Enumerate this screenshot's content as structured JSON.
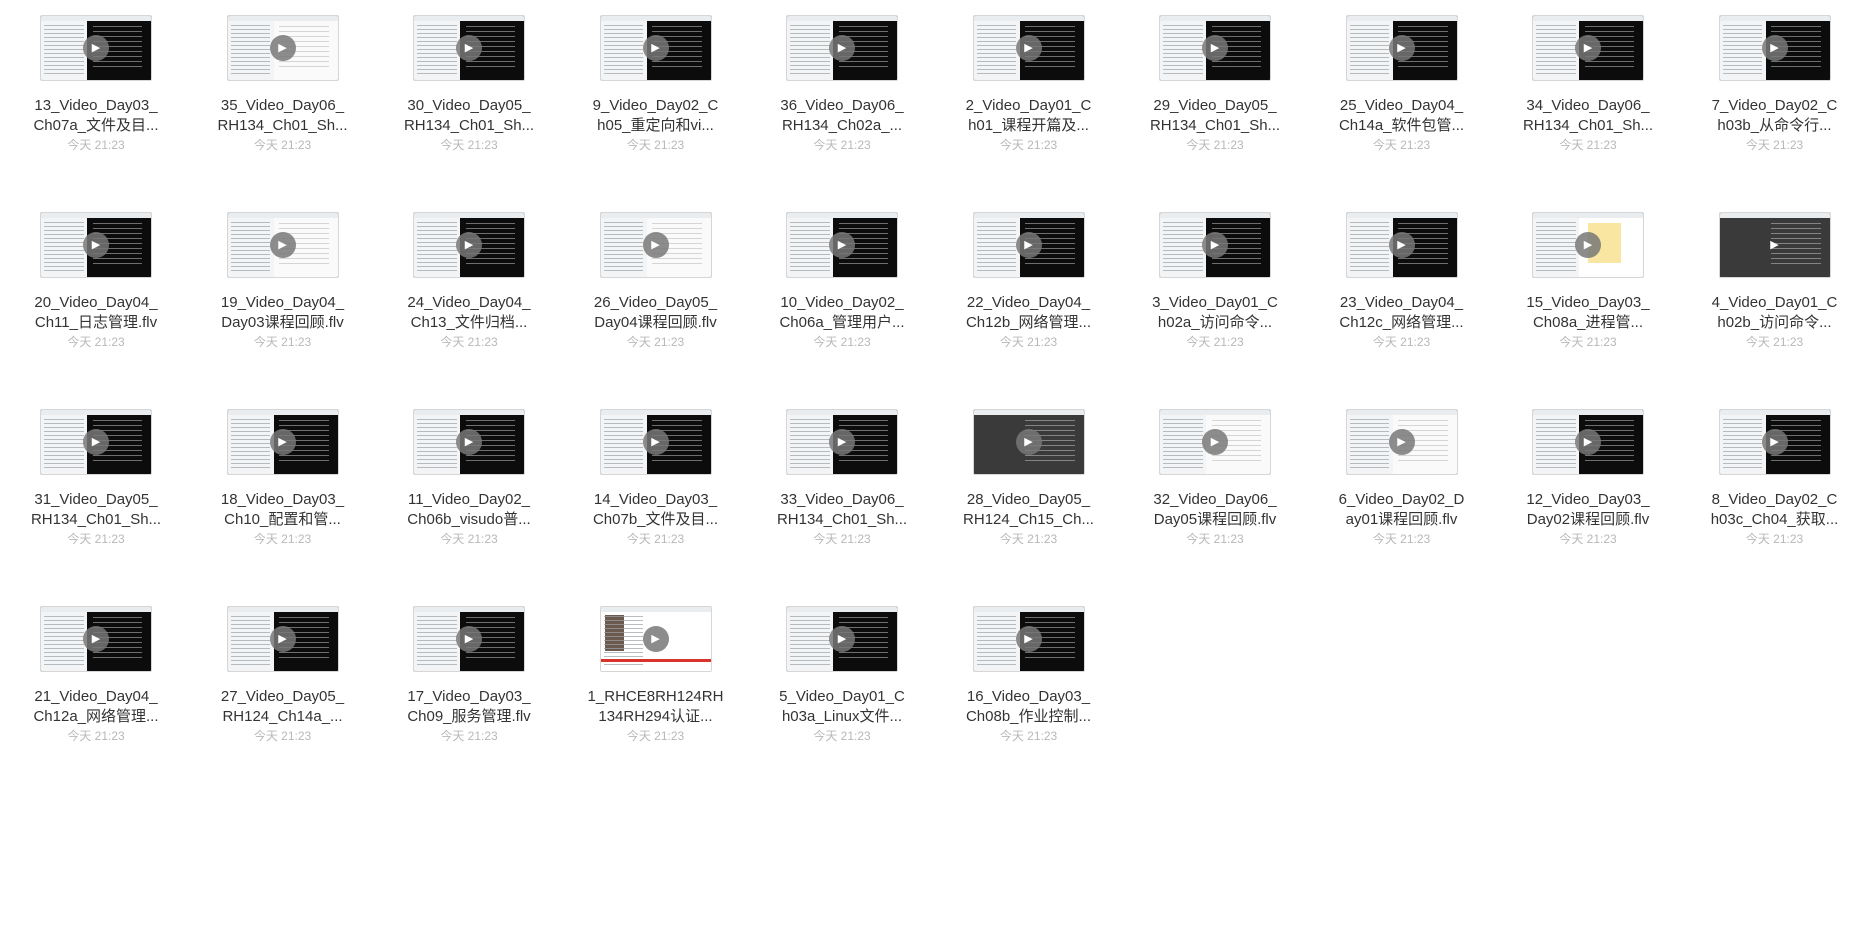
{
  "files": [
    {
      "line1": "13_Video_Day03_",
      "line2": "Ch07a_文件及目...",
      "date": "今天 21:23",
      "thumb": "term"
    },
    {
      "line1": "35_Video_Day06_",
      "line2": "RH134_Ch01_Sh...",
      "date": "今天 21:23",
      "thumb": "light"
    },
    {
      "line1": "30_Video_Day05_",
      "line2": "RH134_Ch01_Sh...",
      "date": "今天 21:23",
      "thumb": "term"
    },
    {
      "line1": "9_Video_Day02_C",
      "line2": "h05_重定向和vi...",
      "date": "今天 21:23",
      "thumb": "term"
    },
    {
      "line1": "36_Video_Day06_",
      "line2": "RH134_Ch02a_...",
      "date": "今天 21:23",
      "thumb": "term"
    },
    {
      "line1": "2_Video_Day01_C",
      "line2": "h01_课程开篇及...",
      "date": "今天 21:23",
      "thumb": "term"
    },
    {
      "line1": "29_Video_Day05_",
      "line2": "RH134_Ch01_Sh...",
      "date": "今天 21:23",
      "thumb": "term"
    },
    {
      "line1": "25_Video_Day04_",
      "line2": "Ch14a_软件包管...",
      "date": "今天 21:23",
      "thumb": "term"
    },
    {
      "line1": "34_Video_Day06_",
      "line2": "RH134_Ch01_Sh...",
      "date": "今天 21:23",
      "thumb": "term"
    },
    {
      "line1": "7_Video_Day02_C",
      "line2": "h03b_从命令行...",
      "date": "今天 21:23",
      "thumb": "term"
    },
    {
      "line1": "20_Video_Day04_",
      "line2": "Ch11_日志管理.flv",
      "date": "今天 21:23",
      "thumb": "term"
    },
    {
      "line1": "19_Video_Day04_",
      "line2": "Day03课程回顾.flv",
      "date": "今天 21:23",
      "thumb": "light"
    },
    {
      "line1": "24_Video_Day04_",
      "line2": "Ch13_文件归档...",
      "date": "今天 21:23",
      "thumb": "term"
    },
    {
      "line1": "26_Video_Day05_",
      "line2": "Day04课程回顾.flv",
      "date": "今天 21:23",
      "thumb": "light"
    },
    {
      "line1": "10_Video_Day02_",
      "line2": "Ch06a_管理用户...",
      "date": "今天 21:23",
      "thumb": "term"
    },
    {
      "line1": "22_Video_Day04_",
      "line2": "Ch12b_网络管理...",
      "date": "今天 21:23",
      "thumb": "term"
    },
    {
      "line1": "3_Video_Day01_C",
      "line2": "h02a_访问命令...",
      "date": "今天 21:23",
      "thumb": "term"
    },
    {
      "line1": "23_Video_Day04_",
      "line2": "Ch12c_网络管理...",
      "date": "今天 21:23",
      "thumb": "term"
    },
    {
      "line1": "15_Video_Day03_",
      "line2": "Ch08a_进程管...",
      "date": "今天 21:23",
      "thumb": "sheet"
    },
    {
      "line1": "4_Video_Day01_C",
      "line2": "h02b_访问命令...",
      "date": "今天 21:23",
      "thumb": "dark"
    },
    {
      "line1": "31_Video_Day05_",
      "line2": "RH134_Ch01_Sh...",
      "date": "今天 21:23",
      "thumb": "term"
    },
    {
      "line1": "18_Video_Day03_",
      "line2": "Ch10_配置和管...",
      "date": "今天 21:23",
      "thumb": "term"
    },
    {
      "line1": "11_Video_Day02_",
      "line2": "Ch06b_visudo普...",
      "date": "今天 21:23",
      "thumb": "term"
    },
    {
      "line1": "14_Video_Day03_",
      "line2": "Ch07b_文件及目...",
      "date": "今天 21:23",
      "thumb": "term"
    },
    {
      "line1": "33_Video_Day06_",
      "line2": "RH134_Ch01_Sh...",
      "date": "今天 21:23",
      "thumb": "term"
    },
    {
      "line1": "28_Video_Day05_",
      "line2": "RH124_Ch15_Ch...",
      "date": "今天 21:23",
      "thumb": "dark"
    },
    {
      "line1": "32_Video_Day06_",
      "line2": "Day05课程回顾.flv",
      "date": "今天 21:23",
      "thumb": "light"
    },
    {
      "line1": "6_Video_Day02_D",
      "line2": "ay01课程回顾.flv",
      "date": "今天 21:23",
      "thumb": "light"
    },
    {
      "line1": "12_Video_Day03_",
      "line2": "Day02课程回顾.flv",
      "date": "今天 21:23",
      "thumb": "term"
    },
    {
      "line1": "8_Video_Day02_C",
      "line2": "h03c_Ch04_获取...",
      "date": "今天 21:23",
      "thumb": "term"
    },
    {
      "line1": "21_Video_Day04_",
      "line2": "Ch12a_网络管理...",
      "date": "今天 21:23",
      "thumb": "term"
    },
    {
      "line1": "27_Video_Day05_",
      "line2": "RH124_Ch14a_...",
      "date": "今天 21:23",
      "thumb": "term"
    },
    {
      "line1": "17_Video_Day03_",
      "line2": "Ch09_服务管理.flv",
      "date": "今天 21:23",
      "thumb": "term"
    },
    {
      "line1": "1_RHCE8RH124RH",
      "line2": "134RH294认证...",
      "date": "今天 21:23",
      "thumb": "ppt"
    },
    {
      "line1": "5_Video_Day01_C",
      "line2": "h03a_Linux文件...",
      "date": "今天 21:23",
      "thumb": "term"
    },
    {
      "line1": "16_Video_Day03_",
      "line2": "Ch08b_作业控制...",
      "date": "今天 21:23",
      "thumb": "term"
    }
  ],
  "icons": {
    "play": "play-icon"
  }
}
